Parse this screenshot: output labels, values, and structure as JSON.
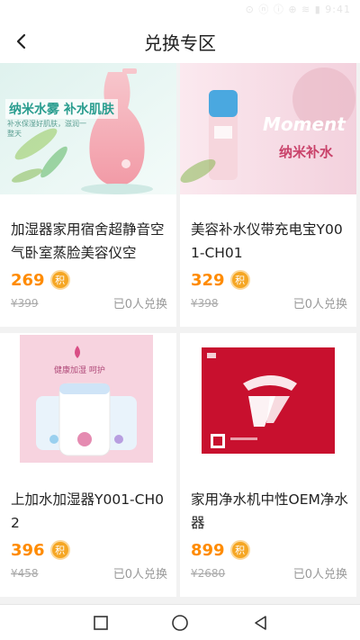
{
  "status_bar": {
    "text": "⊙ ⓝ ⓘ ⊕ ≋ ▮ 9:41"
  },
  "header": {
    "title": "兑换专区"
  },
  "products": [
    {
      "name": "加湿器家用宿舍超静音空气卧室蒸脸美容仪空",
      "price": "269",
      "badge": "积",
      "orig_price": "¥399",
      "exchanged": "已0人兑换",
      "image_text_1": "纳米水雾 补水肌肤",
      "image_text_2": "补水保湿好肌肤，滋润一整天"
    },
    {
      "name": "美容补水仪带充电宝Y001-CH01",
      "price": "329",
      "badge": "积",
      "orig_price": "¥398",
      "exchanged": "已0人兑换",
      "image_text_1": "纳米补水",
      "image_text_2": "Moment"
    },
    {
      "name": "上加水加湿器Y001-CH02",
      "price": "396",
      "badge": "积",
      "orig_price": "¥458",
      "exchanged": "已0人兑换",
      "image_text_1": "健康加湿 呵护",
      "image_text_2": ""
    },
    {
      "name": "家用净水机中性OEM净水器",
      "price": "899",
      "badge": "积",
      "orig_price": "¥2680",
      "exchanged": "已0人兑换",
      "image_text_1": "",
      "image_text_2": ""
    }
  ],
  "nav": {
    "recent_icon": "square-icon",
    "home_icon": "circle-icon",
    "back_icon": "triangle-back-icon"
  },
  "colors": {
    "accent": "#ff8b00",
    "badge": "#f5a623"
  }
}
